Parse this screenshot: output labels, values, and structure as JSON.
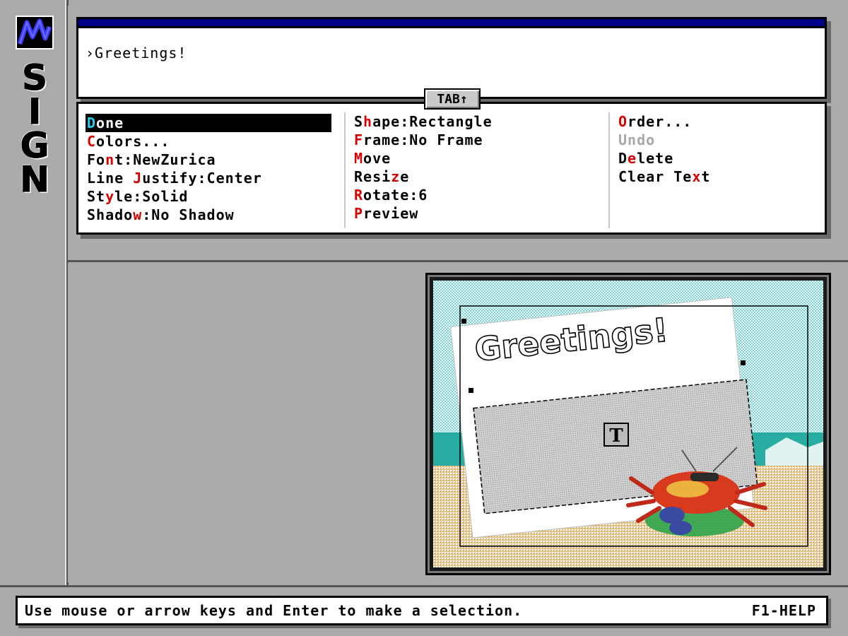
{
  "app": {
    "title_letters": [
      "S",
      "I",
      "G",
      "N"
    ],
    "logo_icon": "m-brand-logo-icon"
  },
  "input": {
    "text": "›Greetings!"
  },
  "tab_button": {
    "label": "TAB↑"
  },
  "menu": {
    "col1": [
      {
        "parts": [
          {
            "hk": true,
            "t": "D"
          },
          {
            "t": "one"
          }
        ],
        "state": "selected"
      },
      {
        "parts": [
          {
            "hk": true,
            "t": "C"
          },
          {
            "t": "olors..."
          }
        ]
      },
      {
        "parts": [
          {
            "t": "Fo"
          },
          {
            "hk": true,
            "t": "n"
          },
          {
            "t": "t:NewZurica"
          }
        ]
      },
      {
        "parts": [
          {
            "t": "Line "
          },
          {
            "hk": true,
            "t": "J"
          },
          {
            "t": "ustify:Center"
          }
        ]
      },
      {
        "parts": [
          {
            "t": "St"
          },
          {
            "hk": true,
            "t": "y"
          },
          {
            "t": "le:Solid"
          }
        ]
      },
      {
        "parts": [
          {
            "t": "Shado"
          },
          {
            "hk": true,
            "t": "w"
          },
          {
            "t": ":No Shadow"
          }
        ]
      }
    ],
    "col2": [
      {
        "parts": [
          {
            "t": "S"
          },
          {
            "hk": true,
            "t": "h"
          },
          {
            "t": "ape:Rectangle"
          }
        ]
      },
      {
        "parts": [
          {
            "hk": true,
            "t": "F"
          },
          {
            "t": "rame:No Frame"
          }
        ]
      },
      {
        "parts": [
          {
            "hk": true,
            "t": "M"
          },
          {
            "t": "ove"
          }
        ]
      },
      {
        "parts": [
          {
            "t": "Resi"
          },
          {
            "hk": true,
            "t": "z"
          },
          {
            "t": "e"
          }
        ]
      },
      {
        "parts": [
          {
            "hk": true,
            "t": "R"
          },
          {
            "t": "otate:6"
          }
        ]
      },
      {
        "parts": [
          {
            "hk": true,
            "t": "P"
          },
          {
            "t": "review"
          }
        ]
      }
    ],
    "col3": [
      {
        "parts": [
          {
            "hk": true,
            "t": "O"
          },
          {
            "t": "rder..."
          }
        ]
      },
      {
        "parts": [
          {
            "t": "Undo"
          }
        ],
        "state": "disabled"
      },
      {
        "parts": [
          {
            "t": "D"
          },
          {
            "hk": true,
            "t": "e"
          },
          {
            "t": "lete"
          }
        ]
      },
      {
        "parts": [
          {
            "t": "Clear Te"
          },
          {
            "hk": true,
            "t": "x"
          },
          {
            "t": "t"
          }
        ]
      }
    ]
  },
  "preview": {
    "sign_text": "Greetings!",
    "text_tool_glyph": "T",
    "colors": {
      "sky": "#5fd3d3",
      "sea": "#1aa39a",
      "sand": "#e6c28c",
      "card": "#ffffff",
      "crab": "#d83a1e"
    }
  },
  "status": {
    "message": "Use mouse or arrow keys and Enter to make a selection.",
    "help": "F1-HELP"
  }
}
